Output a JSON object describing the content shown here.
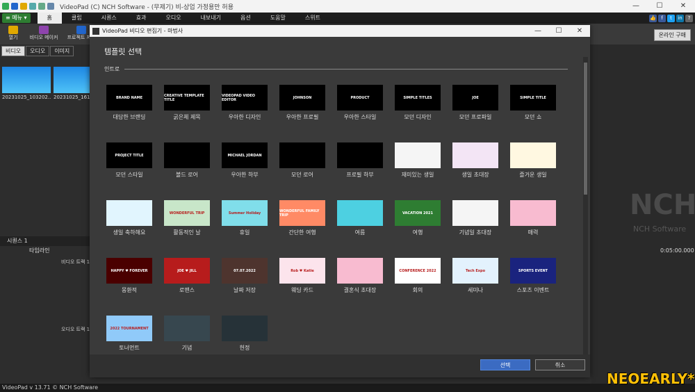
{
  "window": {
    "title": "VideoPad (C) NCH Software - (무제기) 비-상업 가정용만 허용",
    "controls": [
      "—",
      "☐",
      "✕"
    ]
  },
  "menubar": {
    "menu_label": "≡ 메뉴 ▾",
    "tabs": [
      "홈",
      "클립",
      "시퀀스",
      "효과",
      "오디오",
      "내보내기",
      "옵션",
      "도움말",
      "스위트"
    ],
    "active_tab": 0
  },
  "toolbar": {
    "items": [
      "열기",
      "비디오 메이커",
      "프로젝트 저장"
    ],
    "buy_label": "온라인 구매"
  },
  "bin": {
    "tabs": [
      "비디오",
      "오디오",
      "이미지"
    ],
    "clips": [
      "20231025_103202...",
      "20231025_16114"
    ]
  },
  "sequence": {
    "tab": "시퀀스 1",
    "timeline_label": "타임라인",
    "video_track": "비디오 트랙 1",
    "audio_track": "오디오 트랙 1",
    "timecode": "0:05:00.000"
  },
  "watermark": {
    "brand": "NCH",
    "sub": "NCH Software",
    "overlay": "NEOEARLY*"
  },
  "status": {
    "text": "VideoPad v 13.71 © NCH Software"
  },
  "dialog": {
    "title": "VideoPad 비디오 편집기 - 마법사",
    "heading": "템플릿 선택",
    "section": "인트로",
    "ok_label": "선택",
    "cancel_label": "취소",
    "templates": [
      {
        "label": "대담한 브랜딩",
        "text": "BRAND NAME",
        "bg": "#000000"
      },
      {
        "label": "굵은체 제목",
        "text": "CREATIVE TEMPLATE TITLE",
        "bg": "#000000"
      },
      {
        "label": "우아한 디자인",
        "text": "VIDEOPAD VIDEO EDITOR",
        "bg": "#000000"
      },
      {
        "label": "우아한 프로필",
        "text": "JOHNSON",
        "bg": "#000000"
      },
      {
        "label": "우아한 스타일",
        "text": "PRODUCT",
        "bg": "#000000"
      },
      {
        "label": "모던 디자인",
        "text": "SIMPLE TITLES",
        "bg": "#000000"
      },
      {
        "label": "모던 프로파일",
        "text": "JOE",
        "bg": "#000000"
      },
      {
        "label": "모던 쇼",
        "text": "SIMPLE TITLE",
        "bg": "#000000"
      },
      {
        "label": "모던 스타일",
        "text": "PROJECT TITLE",
        "bg": "#000000"
      },
      {
        "label": "볼드 로어",
        "text": "",
        "bg": "#000000"
      },
      {
        "label": "우아한 하부",
        "text": "MICHAEL JORDAN",
        "bg": "#000000"
      },
      {
        "label": "모던 로어",
        "text": "",
        "bg": "#000000"
      },
      {
        "label": "프로필 하부",
        "text": "",
        "bg": "#000000"
      },
      {
        "label": "재미있는 생일",
        "text": "",
        "bg": "#f5f5f5"
      },
      {
        "label": "생일 초대장",
        "text": "",
        "bg": "#f3e5f5"
      },
      {
        "label": "즐거운 생일",
        "text": "",
        "bg": "#fff8e1"
      },
      {
        "label": "생일 축하해요",
        "text": "",
        "bg": "#e1f5fe"
      },
      {
        "label": "활동적인 날",
        "text": "WONDERFUL TRIP",
        "bg": "#c8e6c9"
      },
      {
        "label": "휴일",
        "text": "Summer Holiday",
        "bg": "#80deea"
      },
      {
        "label": "간단한 여행",
        "text": "WONDERFUL FAMILY TRIP",
        "bg": "#ff8a65"
      },
      {
        "label": "여름",
        "text": "",
        "bg": "#4dd0e1"
      },
      {
        "label": "여행",
        "text": "VACATION 2021",
        "bg": "#2e7d32"
      },
      {
        "label": "기념일 초대장",
        "text": "",
        "bg": "#f5f5f5"
      },
      {
        "label": "매력",
        "text": "",
        "bg": "#f8bbd0"
      },
      {
        "label": "몽환적",
        "text": "HAPPY ♥ FOREVER",
        "bg": "#4a0000"
      },
      {
        "label": "로맨스",
        "text": "JOE ♥ JILL",
        "bg": "#b71c1c"
      },
      {
        "label": "날짜 저장",
        "text": "07.07.2022",
        "bg": "#4e342e"
      },
      {
        "label": "웨딩 카드",
        "text": "Rob ♥ Katie",
        "bg": "#fce4ec"
      },
      {
        "label": "결혼식 초대장",
        "text": "",
        "bg": "#f8bbd0"
      },
      {
        "label": "회의",
        "text": "CONFERENCE 2022",
        "bg": "#ffffff"
      },
      {
        "label": "세미나",
        "text": "Tech Expo",
        "bg": "#e3f2fd"
      },
      {
        "label": "스포츠 이벤트",
        "text": "SPORTS EVENT",
        "bg": "#1a237e"
      },
      {
        "label": "토너먼트",
        "text": "2022 TOURNAMENT",
        "bg": "#90caf9"
      },
      {
        "label": "기념",
        "text": "",
        "bg": "#37474f"
      },
      {
        "label": "헌정",
        "text": "",
        "bg": "#263238"
      }
    ]
  }
}
